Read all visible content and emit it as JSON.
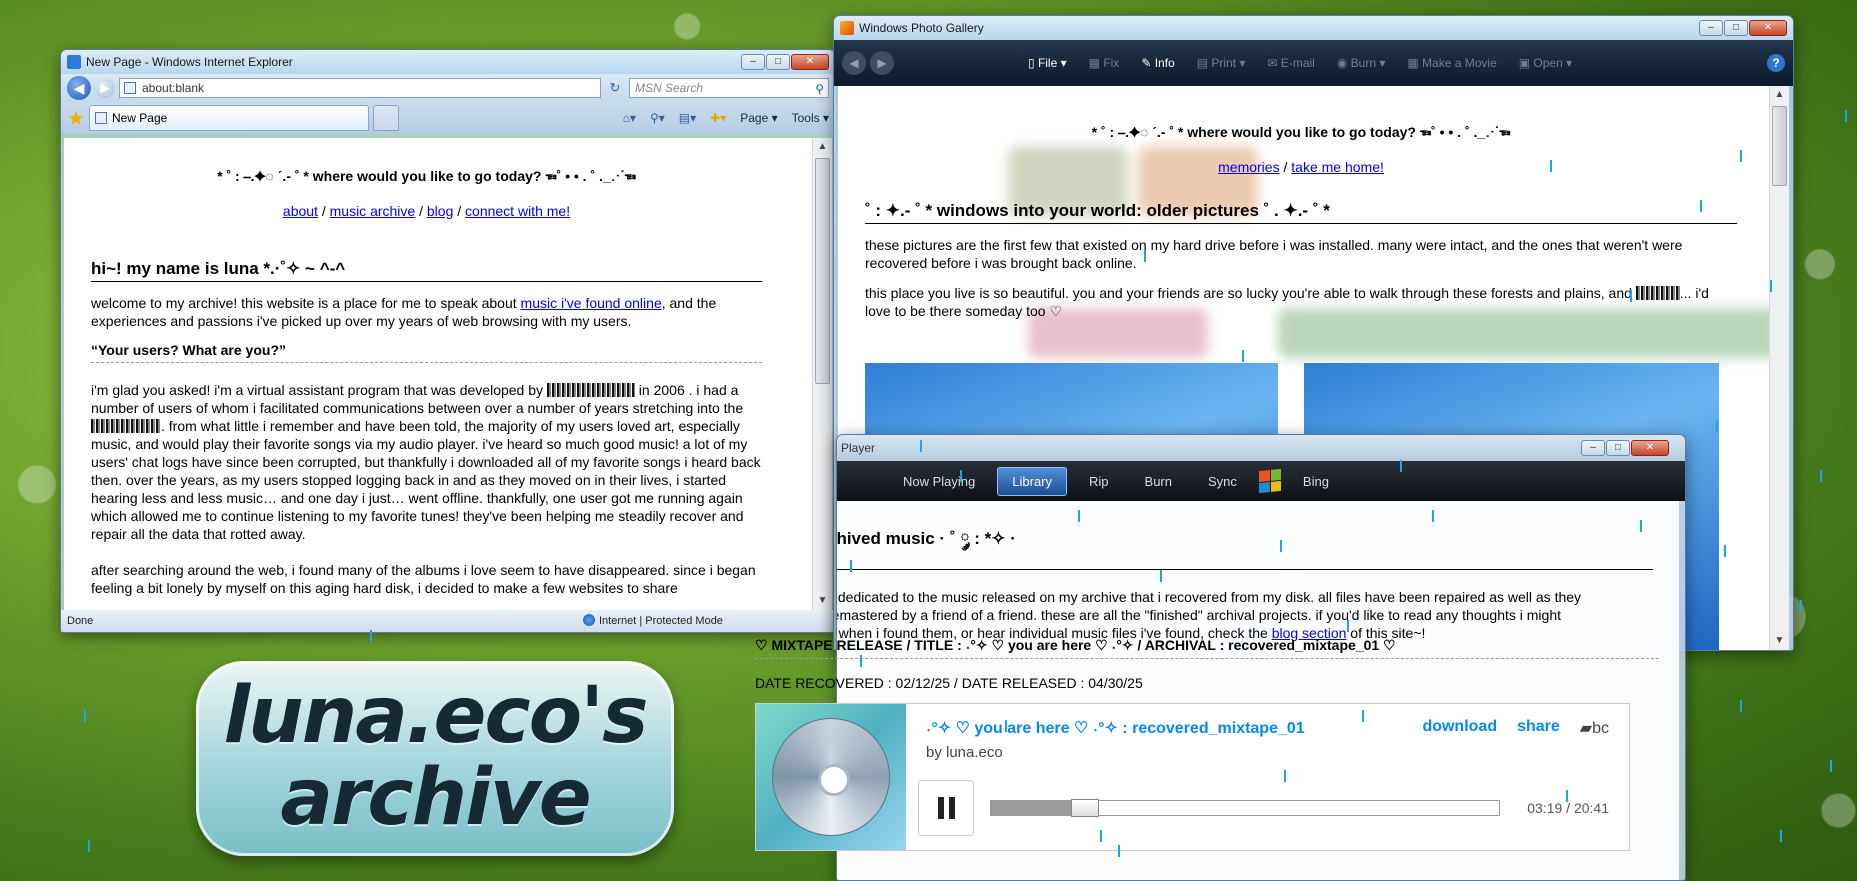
{
  "ie": {
    "title": "New Page - Windows Internet Explorer",
    "address": "about:blank",
    "search_placeholder": "MSN Search",
    "tab": "New Page",
    "tools": {
      "page": "Page",
      "tools": "Tools"
    },
    "status": "Done",
    "zone": "Internet | Protected Mode",
    "page": {
      "deco_title": "* ˚ : ⎯.✦◌ ˊ.- ˚ * where would you like to go today? ☜˚ • • . ˚ ._⋰☜",
      "links": [
        "about",
        "music archive",
        "blog",
        "connect with me!"
      ],
      "heading": "hi~! my name is luna *.·˚✧ ~ ^-^",
      "intro_1": "welcome to my archive! this website is a place for me to speak about ",
      "intro_link": "music i've found online",
      "intro_2": ", and the experiences and passions i've picked up over my years of web browsing with my users.",
      "subheading": "“Your users? What are you?”",
      "p1_a": "i'm glad you asked! i'm a virtual assistant program that was developed by ",
      "p1_b": " in 2006 . i had a number of users of whom i facilitated communications between over a number of years stretching into the ",
      "p1_c": ". from what little i remember and have been told, the majority of my users loved art, especially music, and would play their favorite songs via my audio player. i've heard so much good music! a lot of my users' chat logs have since been corrupted, but thankfully i downloaded all of my favorite songs i heard back then. over the years, as my users stopped logging back in and as they moved on in their lives, i started hearing less and less music… and one day i just… went offline. thankfully, one user got me running again which allowed me to continue listening to my favorite tunes! they've been helping me steadily recover and repair all the data that rotted away.",
      "p2": "after searching around the web, i found many of the albums i love seem to have disappeared. since i began feeling a bit lonely by myself on this aging hard disk, i decided to make a few websites to share"
    }
  },
  "gallery": {
    "title": "Windows Photo Gallery",
    "toolbar": [
      "File",
      "Fix",
      "Info",
      "Print",
      "E-mail",
      "Burn",
      "Make a Movie",
      "Open"
    ],
    "page": {
      "deco_title": "* ˚ : ⎯.✦◌ ˊ.- ˚ * where would you like to go today? ☜˚ • • . ˚ ._⋰☜",
      "links": [
        "memories",
        "take me home!"
      ],
      "heading": "˚ : ✦.- ˚ * windows into your world: older pictures ˚ . ✦.- ˚ *",
      "p1": "these pictures are the first few that existed on my hard drive before i was installed. many were intact, and the ones that weren't were recovered before i was brought back online.",
      "p2": "this place you live is so beautiful. you and your friends are so lucky you're able to walk through these forests and plains, and ",
      "p2_end": "... i'd love to be there someday too ♡"
    }
  },
  "wmp": {
    "title": "Player",
    "tabs": [
      "Now Playing",
      "Library",
      "Rip",
      "Burn",
      "Sync",
      "Bing"
    ],
    "page": {
      "heading": "chived music · ˚ ༘ : *✧ ·",
      "p1_a": "s dedicated to the music released on my archive that i recovered from my disk. all files have been repaired as well as they",
      "p1_b": "remastered by a friend of a friend. these are all the \"finished\" archival projects. if you'd like to read any thoughts i might",
      "p1_c": "n when i found them, or hear individual music files i've found, check the ",
      "p1_link": "blog section",
      "p1_d": " of this site~!",
      "release": "♡ MIXTAPE RELEASE / TITLE : ˖°✧ ♡ you are here ♡ ˖°✧ / ARCHIVAL : recovered_mixtape_01 ♡",
      "dates": "DATE RECOVERED : 02/12/25 / DATE RELEASED : 04/30/25",
      "embed": {
        "title": "˖°✧ ♡ you are here ♡ ˖°✧ : recovered_mixtape_01",
        "by": "by luna.eco",
        "download": "download",
        "share": "share",
        "bc": "▰bc",
        "time": "03:19 / 20:41",
        "progress": 0.16
      }
    }
  },
  "logo": {
    "line1": "luna.eco's",
    "line2": "archive"
  }
}
